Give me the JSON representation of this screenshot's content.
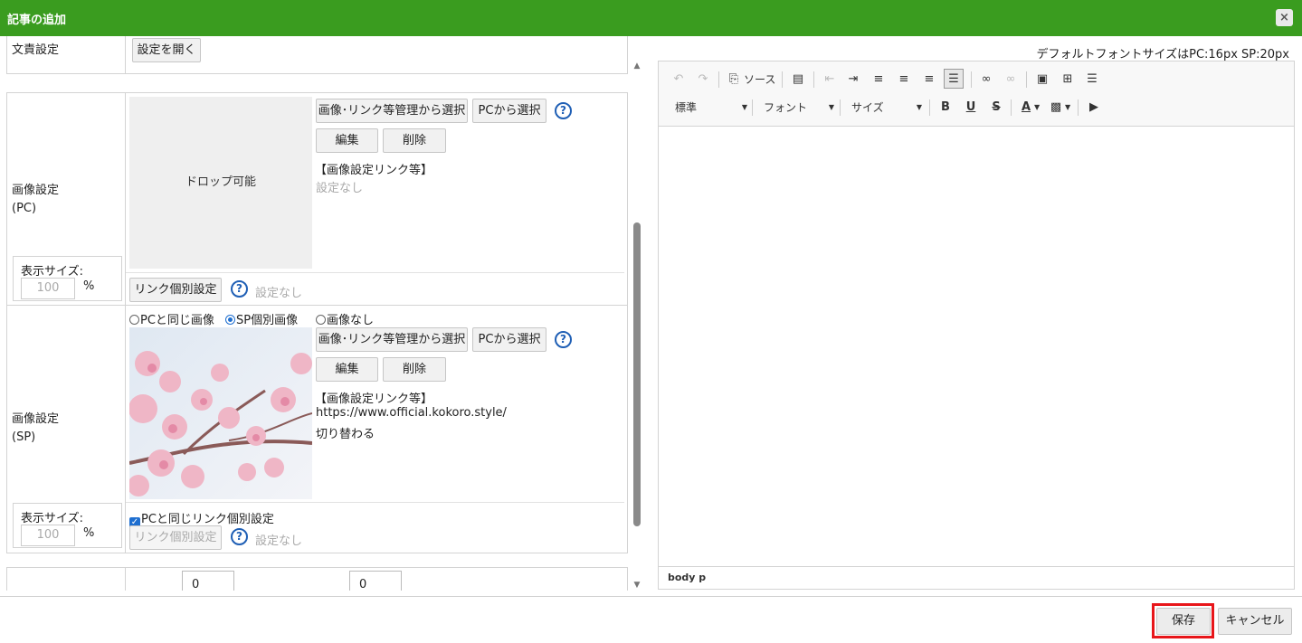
{
  "dialog": {
    "title": "記事の追加",
    "close_icon": "×"
  },
  "left": {
    "top_row": {
      "label": "文責設定",
      "button": "設定を開く"
    },
    "pc": {
      "label_line1": "画像設定",
      "label_line2": "(PC)",
      "dropzone": "ドロップ可能",
      "select_manage": "画像･リンク等管理から選択",
      "select_pc": "PCから選択",
      "help": "?",
      "edit": "編集",
      "delete": "削除",
      "link_heading": "【画像設定リンク等】",
      "link_value": "設定なし",
      "size_label": "表示サイズ:",
      "size_placeholder": "100",
      "size_unit": "%",
      "link_individual": "リンク個別設定",
      "link_individual_status": "設定なし"
    },
    "sp": {
      "label_line1": "画像設定",
      "label_line2": "(SP)",
      "radio_same": "PCと同じ画像",
      "radio_individual": "SP個別画像",
      "radio_none": "画像なし",
      "select_manage": "画像･リンク等管理から選択",
      "select_pc": "PCから選択",
      "help": "?",
      "edit": "編集",
      "delete": "削除",
      "link_heading": "【画像設定リンク等】",
      "link_url": "https://www.official.kokoro.style/",
      "link_behavior": "切り替わる",
      "size_label": "表示サイズ:",
      "size_placeholder": "100",
      "size_unit": "%",
      "same_link_checkbox": "PCと同じリンク個別設定",
      "link_individual": "リンク個別設定",
      "link_individual_status": "設定なし"
    },
    "bottom_row": {
      "value1": "0",
      "value2": "0"
    }
  },
  "editor": {
    "hint": "デフォルトフォントサイズはPC:16px SP:20px",
    "source_label": "ソース",
    "format_dd": "標準",
    "font_dd": "フォント",
    "size_dd": "サイズ",
    "status_path": "body  p"
  },
  "footer": {
    "save": "保存",
    "cancel": "キャンセル"
  },
  "colors": {
    "titlebar": "#3a9c1f",
    "highlight": "#e8161a",
    "accent": "#1f6fd0"
  }
}
